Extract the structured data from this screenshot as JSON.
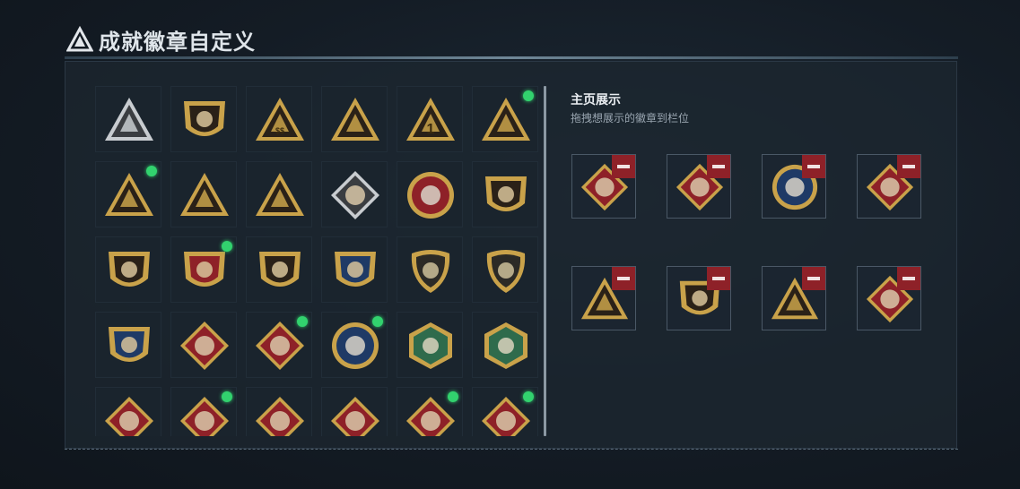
{
  "header": {
    "title": "成就徽章自定义"
  },
  "showcase": {
    "title": "主页展示",
    "subtitle": "拖拽想展示的徽章到栏位"
  },
  "badge_grid": [
    {
      "icon": "silver-triangle-shield-badge",
      "new": false
    },
    {
      "icon": "helicopter-shield-badge",
      "new": false
    },
    {
      "icon": "bag-triangle-badge",
      "new": false,
      "text": "$$"
    },
    {
      "icon": "ship-triangle-badge",
      "new": false
    },
    {
      "icon": "rank-one-triangle-badge",
      "new": false,
      "text": "1"
    },
    {
      "icon": "supply-triangle-badge",
      "new": true
    },
    {
      "icon": "crest-triangle-badge",
      "new": true
    },
    {
      "icon": "soldiers-triangle-badge",
      "new": false
    },
    {
      "icon": "rocket-triangle-badge",
      "new": false
    },
    {
      "icon": "silver-diamond-badge",
      "new": false
    },
    {
      "icon": "star-circle-badge",
      "new": false
    },
    {
      "icon": "rank-shield-badge",
      "new": false
    },
    {
      "icon": "star-crest-shield-badge",
      "new": false
    },
    {
      "icon": "red-crest-shield-badge",
      "new": true
    },
    {
      "icon": "skull-crosshair-badge",
      "new": false
    },
    {
      "icon": "blue-rifle-shield-badge",
      "new": false
    },
    {
      "icon": "rifle-round-shield-badge",
      "new": false
    },
    {
      "icon": "bat-round-shield-badge",
      "new": false
    },
    {
      "icon": "blue-gold-wing-shield-badge",
      "new": false
    },
    {
      "icon": "wolf-diamond-badge",
      "new": false
    },
    {
      "icon": "wolf-diamond-badge-2",
      "new": true
    },
    {
      "icon": "eagle-circle-badge",
      "new": true
    },
    {
      "icon": "green-bird-hexagon-badge",
      "new": false
    },
    {
      "icon": "green-cross-hexagon-badge",
      "new": false
    },
    {
      "icon": "dragon-diamond-badge",
      "new": false
    },
    {
      "icon": "dragon-diamond-badge-2",
      "new": true
    },
    {
      "icon": "runner-diamond-badge",
      "new": false
    },
    {
      "icon": "backpack-diamond-badge",
      "new": false
    },
    {
      "icon": "armor-diamond-badge",
      "new": true
    },
    {
      "icon": "tools-diamond-badge",
      "new": true
    }
  ],
  "showcase_slots": [
    {
      "icon": "wolf-diamond-badge"
    },
    {
      "icon": "dragon-diamond-badge"
    },
    {
      "icon": "eagle-circle-badge"
    },
    {
      "icon": "tools-diamond-badge"
    },
    {
      "icon": "supply-triangle-badge"
    },
    {
      "icon": "star-crest-shield-badge"
    },
    {
      "icon": "crest-triangle-badge"
    },
    {
      "icon": "armor-diamond-badge"
    }
  ],
  "colors": {
    "gold": "#c9a24a",
    "gold_dark": "#7d5f22",
    "red": "#8e2128",
    "navy": "#1f3a66",
    "green": "#2f6b4c",
    "new_dot": "#32d26e",
    "remove_button": "#8e2128"
  }
}
